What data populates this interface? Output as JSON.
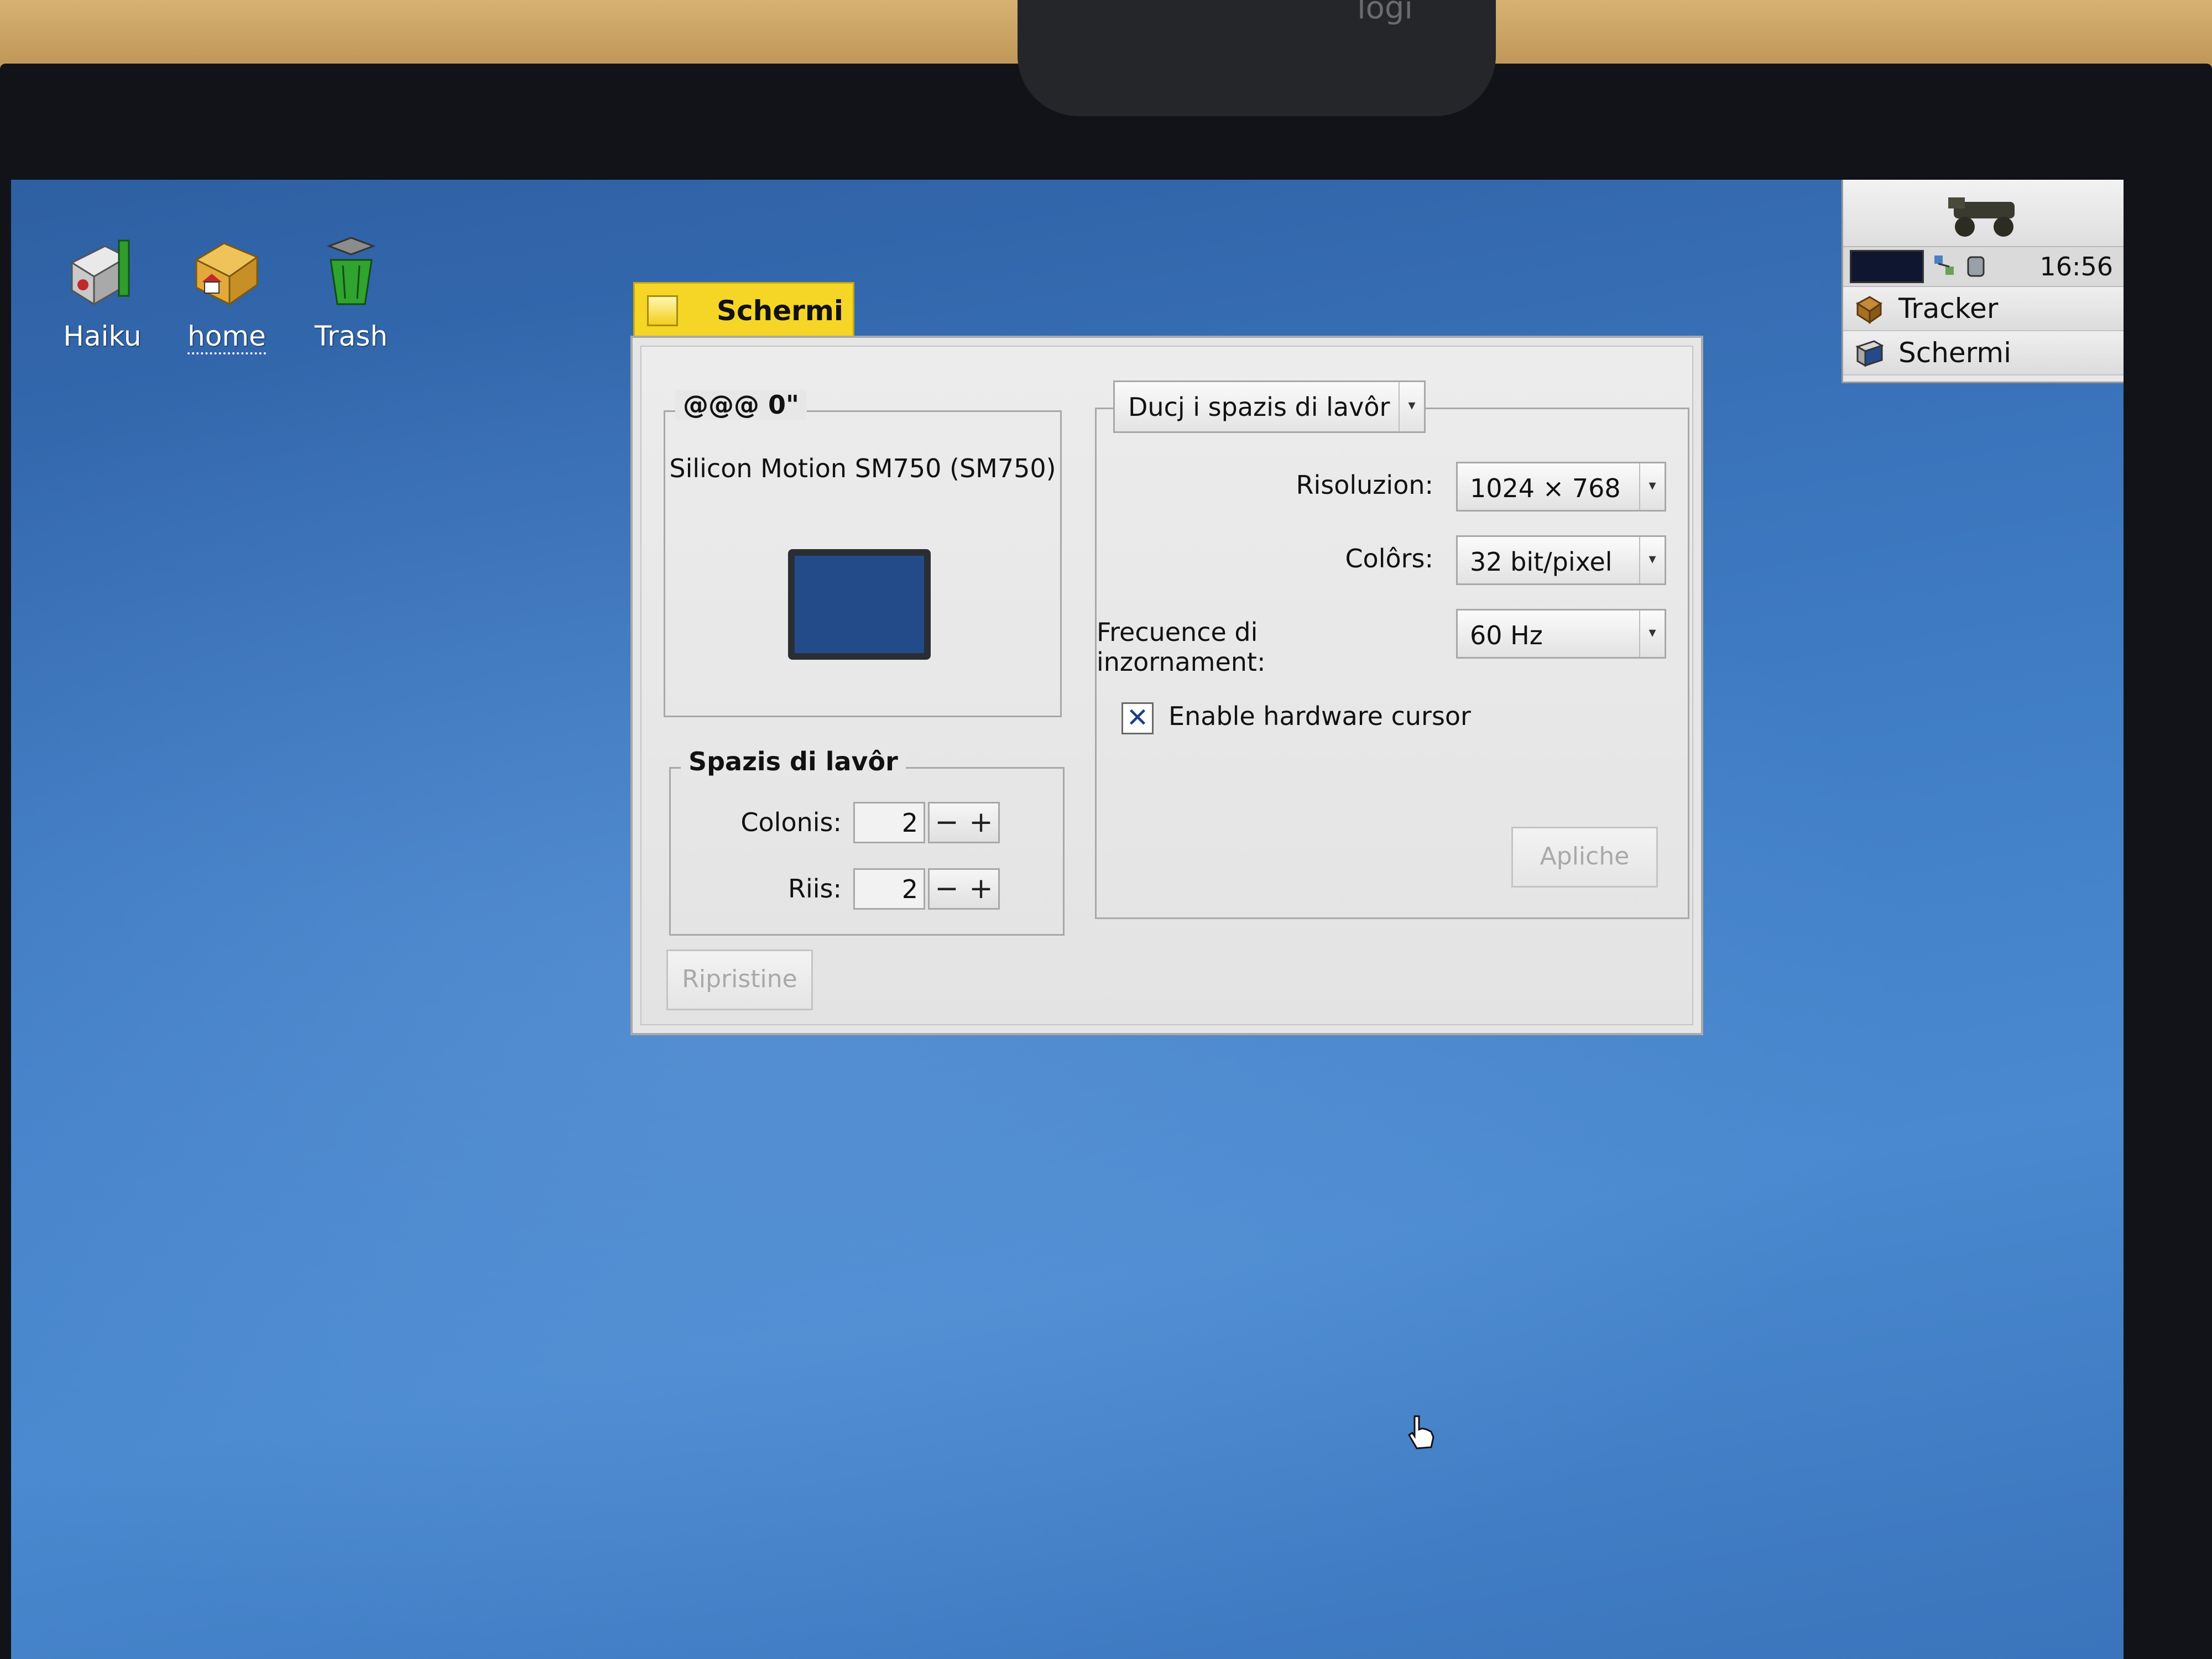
{
  "webcam_brand": "logi",
  "desktop": {
    "icons": [
      {
        "label": "Haiku"
      },
      {
        "label": "home"
      },
      {
        "label": "Trash"
      }
    ]
  },
  "deskbar": {
    "clock": "16:56",
    "apps": [
      {
        "label": "Tracker",
        "icon": "tracker-icon"
      },
      {
        "label": "Schermi",
        "icon": "screen-prefs-icon"
      }
    ]
  },
  "window": {
    "title": "Schermi",
    "monitor_group": {
      "title": "@@@ 0\"",
      "card": "Silicon Motion SM750 (SM750)"
    },
    "workspaces_group": {
      "title": "Spazis di lavôr",
      "columns_label": "Colonis:",
      "columns_value": "2",
      "rows_label": "Riis:",
      "rows_value": "2",
      "minus": "−",
      "plus": "+"
    },
    "settings": {
      "scope_menu": "Ducj i spazis di lavôr",
      "resolution_label": "Risoluzion:",
      "resolution_value": "1024 × 768",
      "colors_label": "Colôrs:",
      "colors_value": "32 bit/pixel",
      "refresh_label": "Frecuence di inzornament:",
      "refresh_value": "60 Hz",
      "hw_cursor_label": "Enable hardware cursor",
      "hw_cursor_checked": true,
      "apply_label": "Apliche"
    },
    "revert_label": "Ripristine"
  },
  "colors": {
    "window_tab": "#f5d526",
    "desktop": "#3f7cc4"
  }
}
